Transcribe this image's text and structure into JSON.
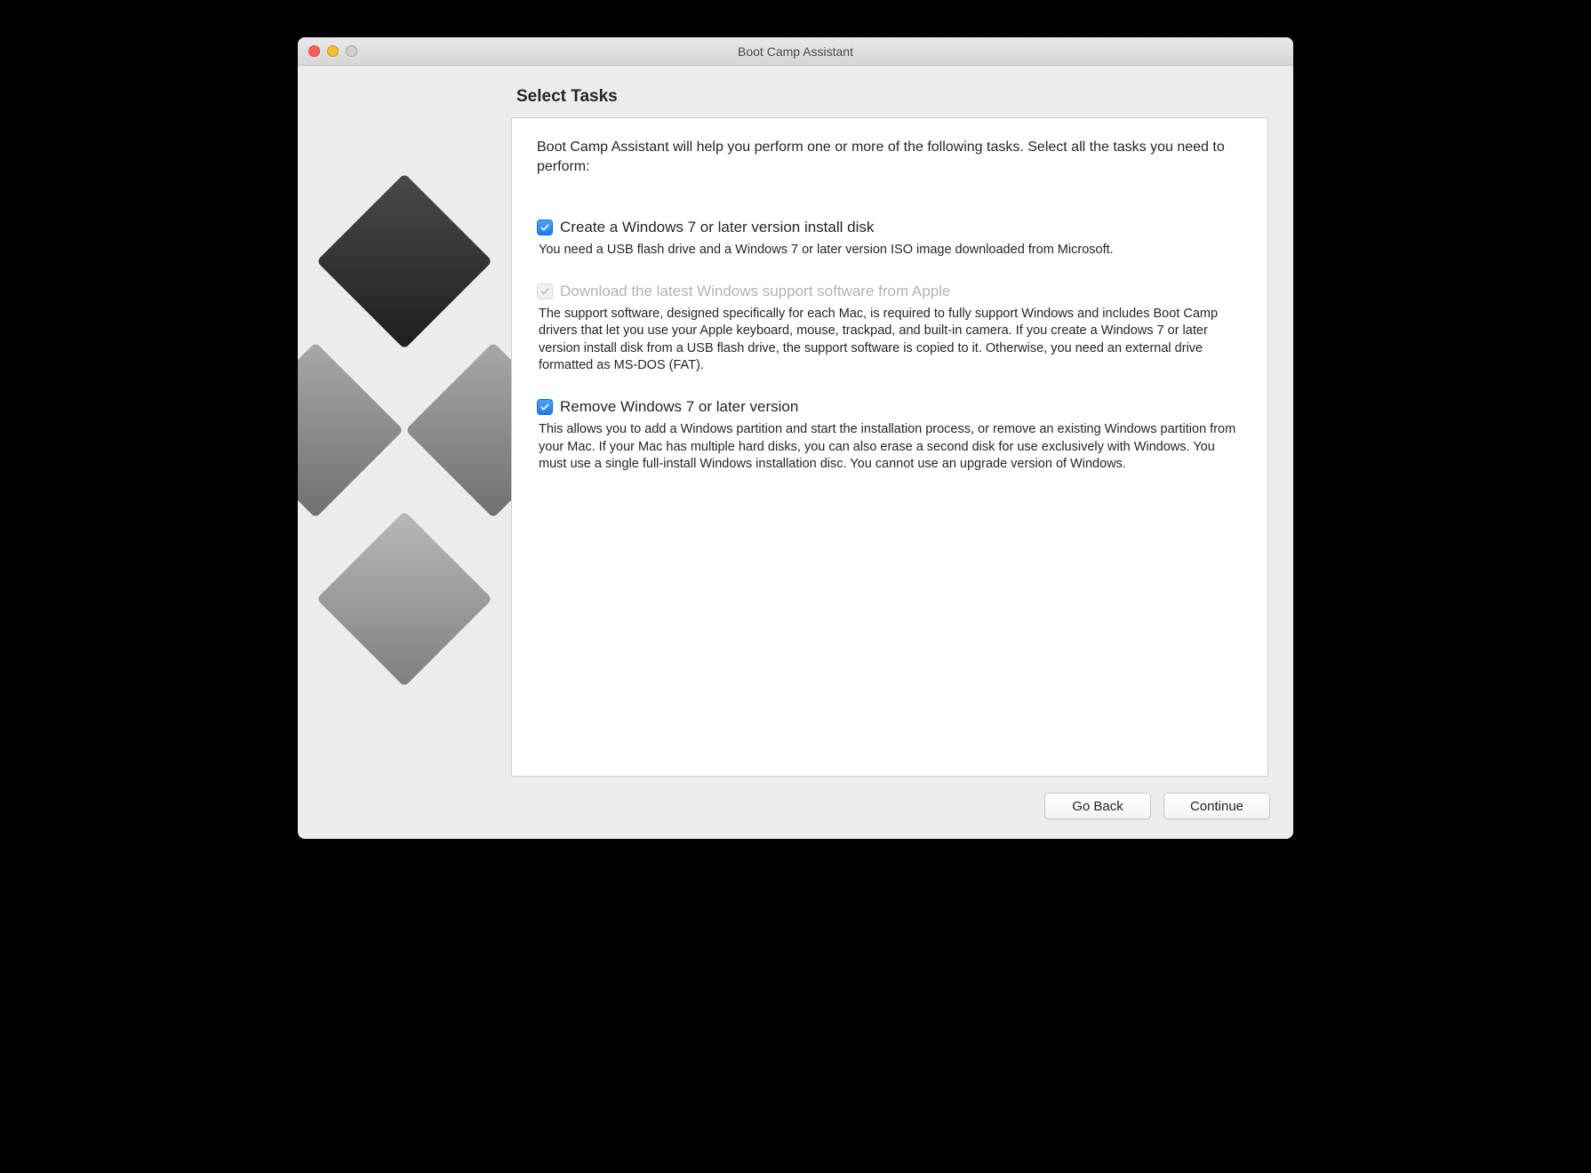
{
  "window": {
    "title": "Boot Camp Assistant"
  },
  "page": {
    "heading": "Select Tasks",
    "intro": "Boot Camp Assistant will help you perform one or more of the following tasks. Select all the tasks you need to perform:"
  },
  "tasks": [
    {
      "label": "Create a Windows 7 or later version install disk",
      "description": "You need a USB flash drive and a Windows 7 or later version ISO image downloaded from Microsoft.",
      "checked": true,
      "enabled": true
    },
    {
      "label": "Download the latest Windows support software from Apple",
      "description": "The support software, designed specifically for each Mac, is required to fully support Windows and includes Boot Camp drivers that let you use your Apple keyboard, mouse, trackpad, and built-in camera. If you create a Windows 7 or later version install disk from a USB flash drive, the support software is copied to it. Otherwise, you need an external drive formatted as MS-DOS (FAT).",
      "checked": true,
      "enabled": false
    },
    {
      "label": "Remove Windows 7 or later version",
      "description": "This allows you to add a Windows partition and start the installation process, or remove an existing Windows partition from your Mac. If your Mac has multiple hard disks, you can also erase a second disk for use exclusively with Windows. You must use a single full-install Windows installation disc. You cannot use an upgrade version of Windows.",
      "checked": true,
      "enabled": true
    }
  ],
  "buttons": {
    "back": "Go Back",
    "continue": "Continue"
  }
}
